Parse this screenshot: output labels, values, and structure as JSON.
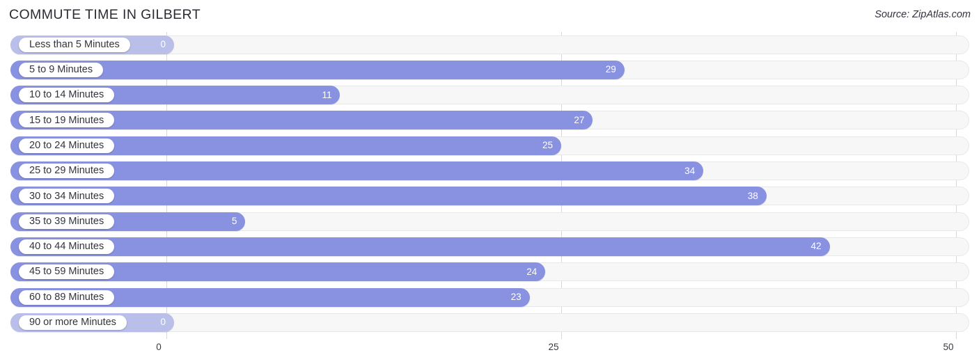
{
  "header": {
    "title": "COMMUTE TIME IN GILBERT",
    "source": "Source: ZipAtlas.com"
  },
  "colors": {
    "bar": "#8892e0",
    "bar_zero": "#b9bfe9",
    "track": "#f7f7f8",
    "gridline": "#d8d8dc",
    "label_text": "#33333d",
    "value_text_outside": "#4a4a55",
    "value_text_inside": "#ffffff"
  },
  "chart_data": {
    "type": "bar",
    "orientation": "horizontal",
    "title": "COMMUTE TIME IN GILBERT",
    "xlabel": "",
    "ylabel": "",
    "xlim": [
      0,
      50
    ],
    "ticks": [
      "0",
      "25",
      "50"
    ],
    "tick_values": [
      0,
      25,
      50
    ],
    "grid": true,
    "legend": "none",
    "categories": [
      "Less than 5 Minutes",
      "5 to 9 Minutes",
      "10 to 14 Minutes",
      "15 to 19 Minutes",
      "20 to 24 Minutes",
      "25 to 29 Minutes",
      "30 to 34 Minutes",
      "35 to 39 Minutes",
      "40 to 44 Minutes",
      "45 to 59 Minutes",
      "60 to 89 Minutes",
      "90 or more Minutes"
    ],
    "values": [
      0,
      29,
      11,
      27,
      25,
      34,
      38,
      5,
      42,
      24,
      23,
      0
    ],
    "value_labels": [
      "0",
      "29",
      "11",
      "27",
      "25",
      "34",
      "38",
      "5",
      "42",
      "24",
      "23",
      "0"
    ]
  }
}
